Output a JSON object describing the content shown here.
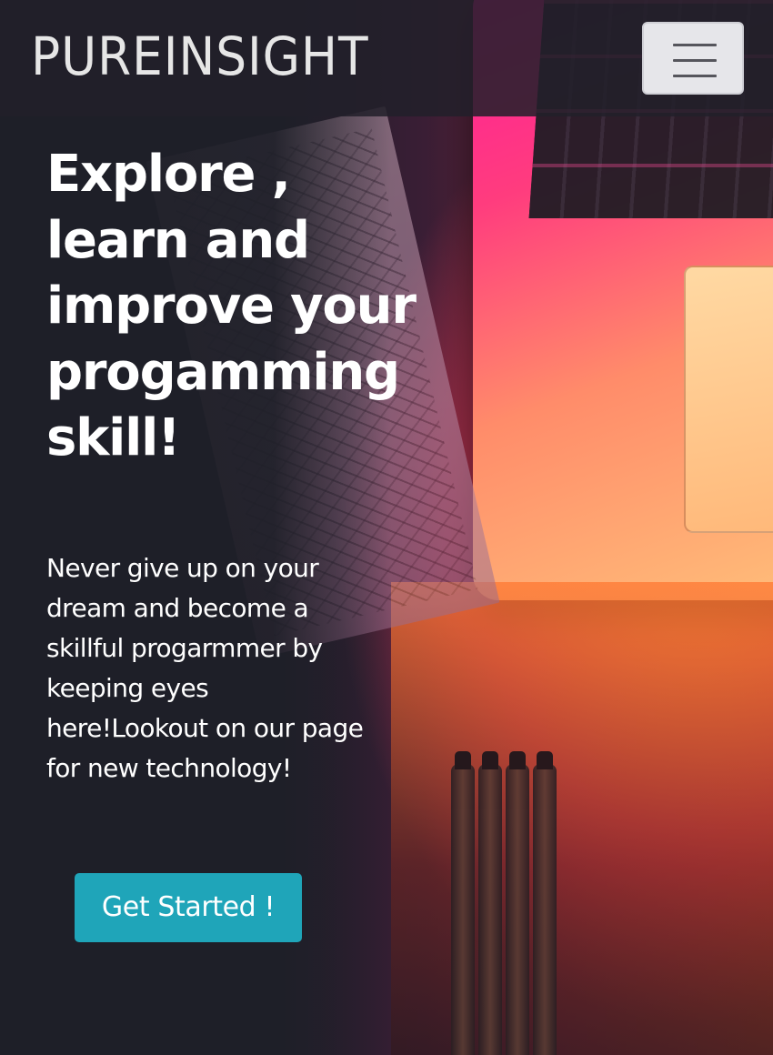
{
  "navbar": {
    "brand": "PUREINSIGHT",
    "menu_icon": "hamburger-menu-icon"
  },
  "hero": {
    "title": "Explore , learn and improve your progamming skill!",
    "text": "Never give up on your dream and become a skillful progarmmer by keeping eyes here!Lookout on our page for new technology!",
    "cta_label": "Get Started !"
  },
  "colors": {
    "cta_background": "#1fa5b9",
    "page_background": "#1e1f28",
    "navbar_toggle_background": "#e6e6ea"
  }
}
